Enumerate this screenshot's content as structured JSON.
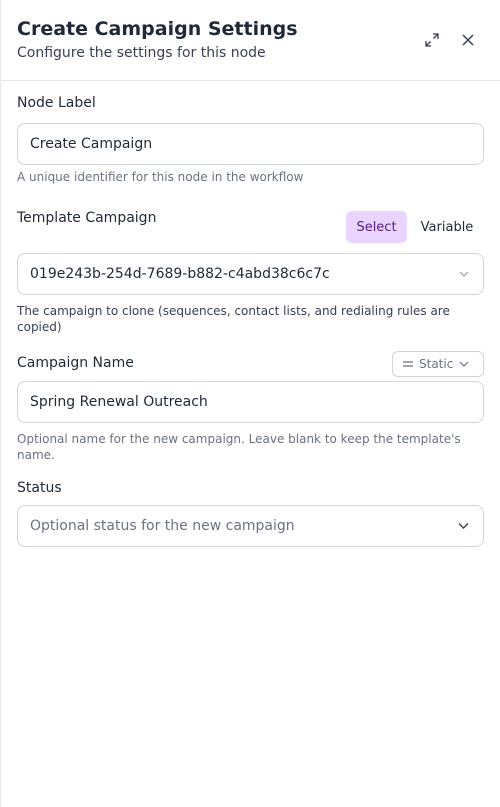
{
  "header": {
    "title": "Create Campaign Settings",
    "subtitle": "Configure the settings for this node",
    "expand_icon": "expand-icon",
    "close_icon": "close-icon"
  },
  "node_label": {
    "label": "Node Label",
    "value": "Create Campaign",
    "help": "A unique identifier for this node in the workflow"
  },
  "template_campaign": {
    "label": "Template Campaign",
    "mode_options": [
      "Select",
      "Variable"
    ],
    "selected_mode": "Select",
    "value": "019e243b-254d-7689-b882-c4abd38c6c7c",
    "help": "The campaign to clone (sequences, contact lists, and redialing rules are copied)"
  },
  "campaign_name": {
    "label": "Campaign Name",
    "mode_label": "Static",
    "value": "Spring Renewal Outreach",
    "help": "Optional name for the new campaign. Leave blank to keep the template's name."
  },
  "status": {
    "label": "Status",
    "placeholder": "Optional status for the new campaign"
  },
  "colors": {
    "accent_bg": "#e9d5ff",
    "accent_text": "#581c87",
    "border": "#d1d5db"
  }
}
